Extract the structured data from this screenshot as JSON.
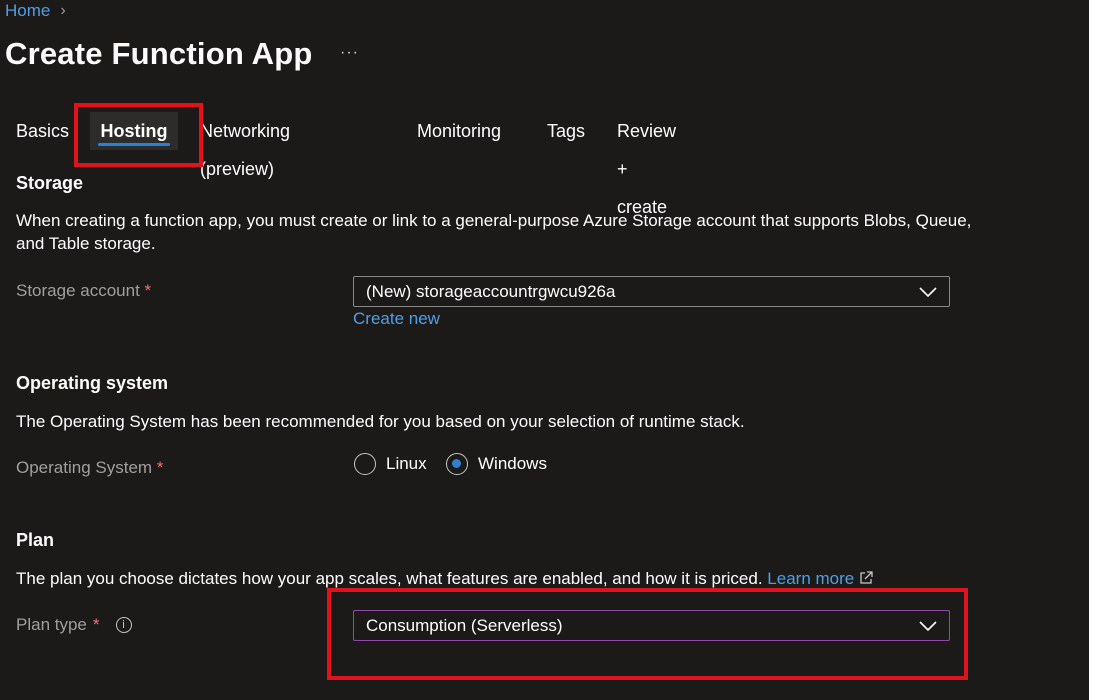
{
  "breadcrumb": {
    "home": "Home",
    "separator": "›"
  },
  "page": {
    "title": "Create Function App",
    "more": "···"
  },
  "tabs": [
    {
      "label": "Basics"
    },
    {
      "label": "Hosting"
    },
    {
      "label": "Networking (preview)"
    },
    {
      "label": "Monitoring"
    },
    {
      "label": "Tags"
    },
    {
      "label": "Review + create"
    }
  ],
  "storage": {
    "heading": "Storage",
    "description": "When creating a function app, you must create or link to a general-purpose Azure Storage account that supports Blobs, Queue, and Table storage.",
    "label": "Storage account",
    "required": "*",
    "value": "(New) storageaccountrgwcu926a",
    "create_new": "Create new"
  },
  "os": {
    "heading": "Operating system",
    "description": "The Operating System has been recommended for you based on your selection of runtime stack.",
    "label": "Operating System",
    "required": "*",
    "options": [
      "Linux",
      "Windows"
    ],
    "selected": "Windows"
  },
  "plan": {
    "heading": "Plan",
    "description": "The plan you choose dictates how your app scales, what features are enabled, and how it is priced.",
    "learn_more": "Learn more",
    "label": "Plan type",
    "required": "*",
    "value": "Consumption (Serverless)"
  },
  "colors": {
    "background": "#1b1a19",
    "link": "#4f9fe6",
    "highlight": "#e1121b",
    "tab_underline": "#2f80d1"
  }
}
